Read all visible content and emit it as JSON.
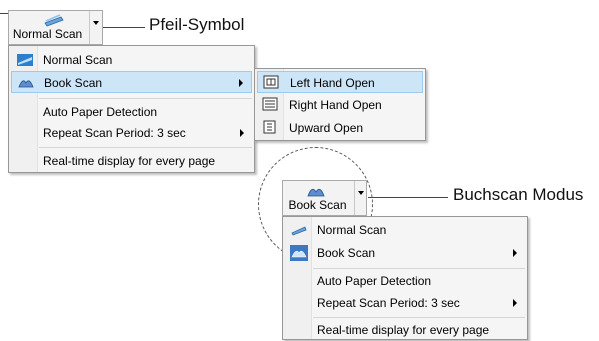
{
  "top": {
    "button_label": "Normal Scan",
    "menu": [
      {
        "label": "Normal Scan",
        "icon": "normal-scan-icon"
      },
      {
        "label": "Book Scan",
        "icon": "book-scan-icon",
        "submenu": true
      },
      {
        "label": "Auto Paper Detection"
      },
      {
        "label": "Repeat Scan Period:  3 sec",
        "submenu": true
      },
      {
        "label": "Real-time display for every page"
      }
    ],
    "submenu": [
      {
        "label": "Left Hand Open",
        "icon": "left-hand-open-icon"
      },
      {
        "label": "Right Hand Open",
        "icon": "right-hand-open-icon"
      },
      {
        "label": "Upward Open",
        "icon": "upward-open-icon"
      }
    ]
  },
  "bottom": {
    "button_label": "Book Scan",
    "menu": [
      {
        "label": "Normal Scan",
        "icon": "normal-scan-icon"
      },
      {
        "label": "Book Scan",
        "icon": "book-scan-icon",
        "submenu": true
      },
      {
        "label": "Auto Paper Detection"
      },
      {
        "label": "Repeat Scan Period:  3 sec",
        "submenu": true
      },
      {
        "label": "Real-time display for every page"
      }
    ]
  },
  "callouts": {
    "arrow": "Pfeil-Symbol",
    "book_mode": "Buchscan Modus"
  },
  "colors": {
    "highlight": "#cde6f7",
    "highlight_border": "#9ccbee",
    "menu_bg": "#f5f5f5"
  }
}
